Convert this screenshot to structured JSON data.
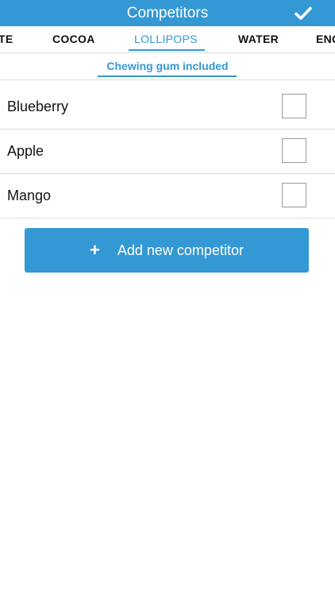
{
  "colors": {
    "accent": "#3498d4",
    "divider": "#dcdcdc"
  },
  "header": {
    "title": "Competitors",
    "confirm_icon": "check-icon"
  },
  "tabs": [
    {
      "label": "TE"
    },
    {
      "label": "COCOA"
    },
    {
      "label": "LOLLIPOPS",
      "active": true
    },
    {
      "label": "WATER"
    },
    {
      "label": "ENG"
    }
  ],
  "subtab": {
    "label": "Chewing gum included"
  },
  "competitors": [
    {
      "name": "Blueberry",
      "checked": false
    },
    {
      "name": "Apple",
      "checked": false
    },
    {
      "name": "Mango",
      "checked": false
    }
  ],
  "add_button": {
    "label": "Add new competitor",
    "icon": "plus-icon"
  }
}
